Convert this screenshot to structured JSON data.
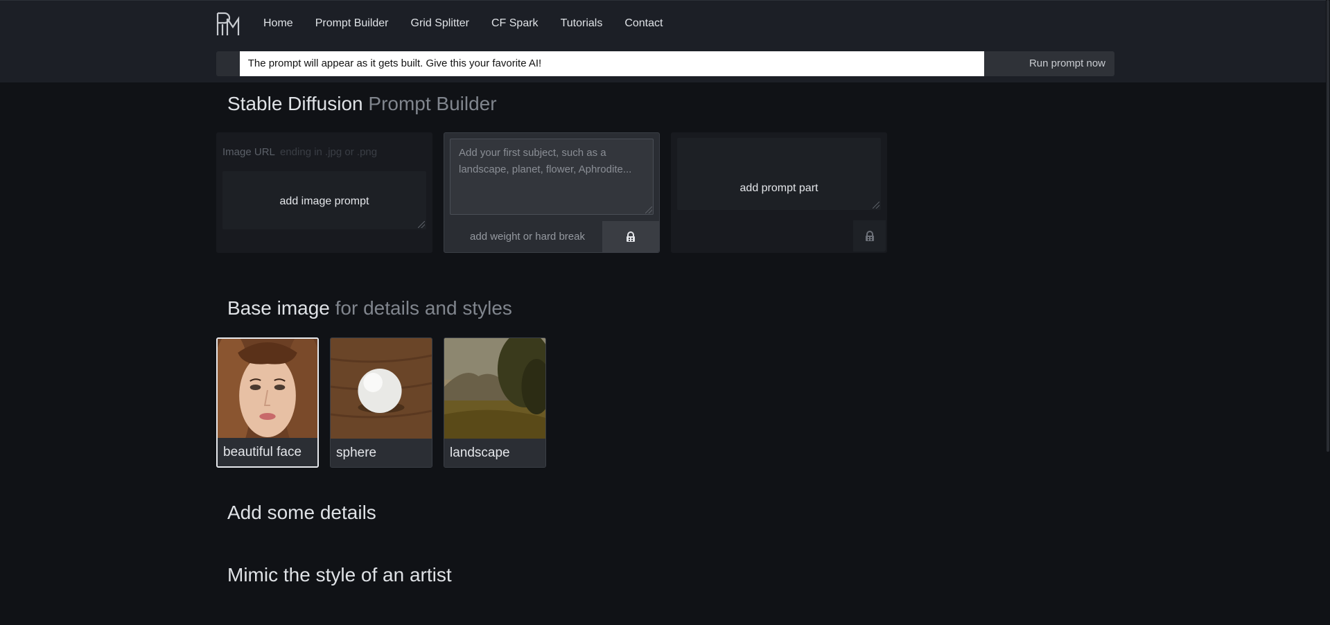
{
  "nav": {
    "logo_alt": "PH",
    "items": [
      {
        "label": "Home"
      },
      {
        "label": "Prompt Builder"
      },
      {
        "label": "Grid Splitter"
      },
      {
        "label": "CF Spark"
      },
      {
        "label": "Tutorials"
      },
      {
        "label": "Contact"
      }
    ]
  },
  "prompt_bar": {
    "output_text": "The prompt will appear as it gets built. Give this your favorite AI!",
    "run_label": "Run prompt now"
  },
  "builder": {
    "title_main": "Stable Diffusion",
    "title_sub": "Prompt Builder",
    "image_card": {
      "url_label": "Image URL",
      "url_placeholder": "ending in .jpg or .png",
      "add_label": "add image prompt"
    },
    "subject_card": {
      "subject_placeholder": "Add your first subject, such as a landscape, planet, flower, Aphrodite...",
      "weight_placeholder": "add weight or hard break"
    },
    "part_card": {
      "add_label": "add prompt part"
    }
  },
  "base_image": {
    "title_main": "Base image",
    "title_sub": "for details and styles",
    "items": [
      {
        "label": "beautiful face",
        "selected": true
      },
      {
        "label": "sphere",
        "selected": false
      },
      {
        "label": "landscape",
        "selected": false
      }
    ]
  },
  "sections": {
    "details_title": "Add some details",
    "artist_title": "Mimic the style of an artist"
  },
  "colors": {
    "page_bg": "#101216",
    "header_bg": "#1c1f26",
    "muted_title": "#80858d"
  }
}
